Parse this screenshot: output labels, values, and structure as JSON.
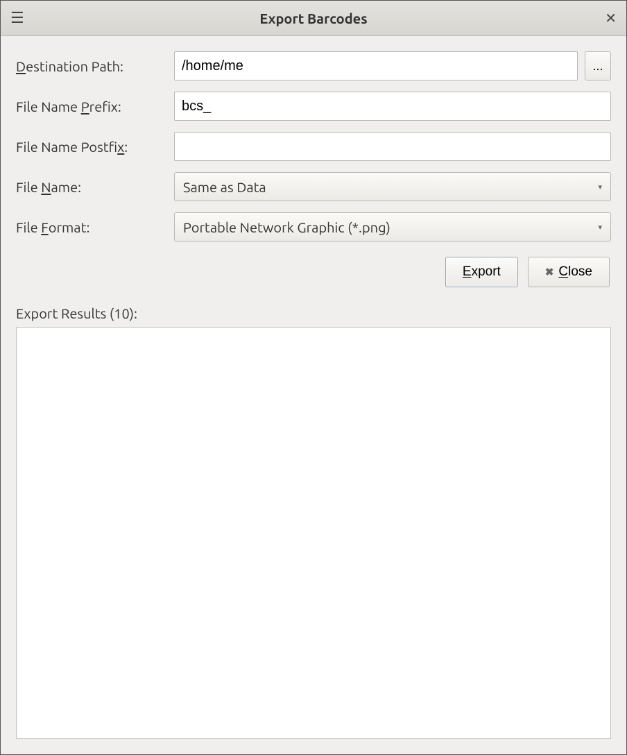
{
  "window": {
    "title": "Export Barcodes"
  },
  "form": {
    "destination": {
      "label_pre": "",
      "label_mnem": "D",
      "label_post": "estination Path:",
      "value": "/home/me",
      "browse_label": "..."
    },
    "prefix": {
      "label_pre": "File Name ",
      "label_mnem": "P",
      "label_post": "refix:",
      "value": "bcs_"
    },
    "postfix": {
      "label_pre": "File Name Postfi",
      "label_mnem": "x",
      "label_post": ":",
      "value": ""
    },
    "file_name": {
      "label_pre": "File ",
      "label_mnem": "N",
      "label_post": "ame:",
      "value": "Same as Data"
    },
    "file_format": {
      "label_pre": "File ",
      "label_mnem": "F",
      "label_post": "ormat:",
      "value": "Portable Network Graphic (*.png)"
    }
  },
  "buttons": {
    "export": {
      "pre": "",
      "mnem": "E",
      "post": "xport"
    },
    "close": {
      "pre": "",
      "mnem": "C",
      "post": "lose"
    }
  },
  "results": {
    "label": "Export Results (10):"
  }
}
